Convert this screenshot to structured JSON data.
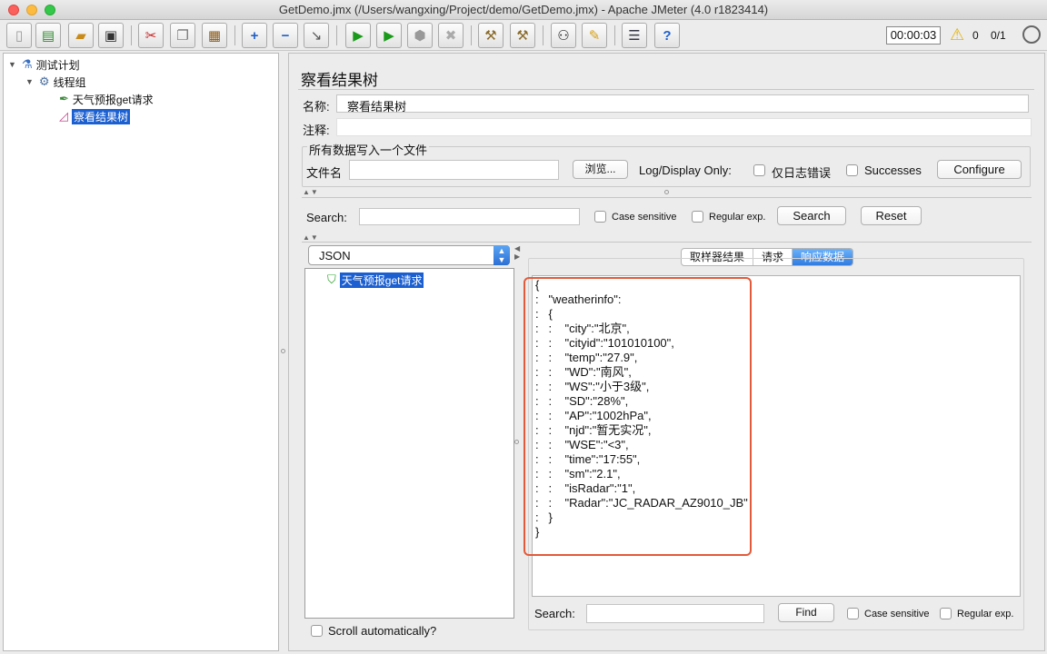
{
  "window": {
    "title": "GetDemo.jmx (/Users/wangxing/Project/demo/GetDemo.jmx) - Apache JMeter (4.0 r1823414)"
  },
  "toolbar": {
    "timer": "00:00:03",
    "warning_count": "0",
    "threads": "0/1",
    "icons": [
      "new-icon",
      "templates-icon",
      "open-icon",
      "save-icon",
      "cut-icon",
      "copy-icon",
      "paste-icon",
      "expand-icon",
      "collapse-icon",
      "toggle-icon",
      "start-icon",
      "start-no-pause-icon",
      "stop-icon",
      "shutdown-icon",
      "clear-icon",
      "clear-all-icon",
      "search-icon",
      "reset-search-icon",
      "function-helper-icon",
      "help-icon"
    ]
  },
  "tree": {
    "plan": "测试计划",
    "thread_group": "线程组",
    "sampler": "天气预报get请求",
    "listener": "察看结果树"
  },
  "panel": {
    "title": "察看结果树",
    "name_label": "名称:",
    "name_value": "察看结果树",
    "comment_label": "注释:",
    "comment_value": "",
    "file_group_title": "所有数据写入一个文件",
    "filename_label": "文件名",
    "filename_value": "",
    "browse_button": "浏览...",
    "log_display_label": "Log/Display Only:",
    "errors_only_label": "仅日志错误",
    "successes_label": "Successes",
    "configure_button": "Configure"
  },
  "search_top": {
    "label": "Search:",
    "value": "",
    "case_sensitive": "Case sensitive",
    "regular_exp": "Regular exp.",
    "search_button": "Search",
    "reset_button": "Reset"
  },
  "results": {
    "renderer": "JSON",
    "sample_item": "天气预报get请求",
    "tabs": [
      "取样器结果",
      "请求",
      "响应数据"
    ],
    "active_tab": 2,
    "scroll_auto": "Scroll automatically?",
    "response_text": "{\n:   \"weatherinfo\":\n:   {\n:   :    \"city\":\"北京\",\n:   :    \"cityid\":\"101010100\",\n:   :    \"temp\":\"27.9\",\n:   :    \"WD\":\"南风\",\n:   :    \"WS\":\"小于3级\",\n:   :    \"SD\":\"28%\",\n:   :    \"AP\":\"1002hPa\",\n:   :    \"njd\":\"暂无实况\",\n:   :    \"WSE\":\"<3\",\n:   :    \"time\":\"17:55\",\n:   :    \"sm\":\"2.1\",\n:   :    \"isRadar\":\"1\",\n:   :    \"Radar\":\"JC_RADAR_AZ9010_JB\"\n:   }\n}"
  },
  "search_bottom": {
    "label": "Search:",
    "value": "",
    "find_button": "Find",
    "case_sensitive": "Case sensitive",
    "regular_exp": "Regular exp."
  },
  "colors": {
    "selection": "#1b5fd0",
    "highlight_box": "#e35a3a",
    "tab_active": "#2f7be0"
  }
}
